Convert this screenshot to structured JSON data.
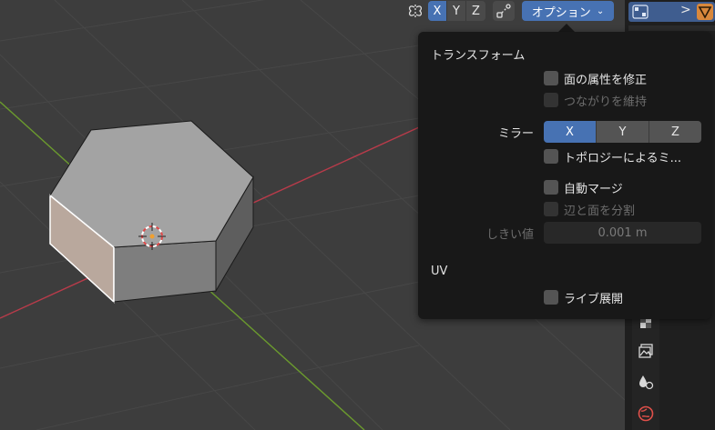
{
  "header": {
    "axes": [
      "X",
      "Y",
      "Z"
    ],
    "active_axis": "X",
    "options_label": "オプション"
  },
  "popup": {
    "transform": {
      "title": "トランスフォーム",
      "correct_face_attributes": "面の属性を修正",
      "keep_connected": "つながりを維持"
    },
    "mirror": {
      "label": "ミラー",
      "axes": [
        "X",
        "Y",
        "Z"
      ],
      "active": "X",
      "topology_mirror": "トポロジーによるミ..."
    },
    "automerge": {
      "label": "自動マージ",
      "split_edges_faces": "辺と面を分割",
      "threshold_label": "しきい値",
      "threshold_value": "0.001 m"
    },
    "uv": {
      "title": "UV",
      "live_unwrap": "ライブ展開"
    }
  },
  "icons": {
    "mirror": "mirror-butterfly-icon",
    "snap": "snap-icon",
    "chevron": "chevron-down-icon",
    "outliner_object": "object-icon",
    "outliner_mesh": "mesh-data-icon",
    "texture_tab": "texture-tab-icon",
    "image_tab": "image-tab-icon",
    "physics_tab": "physics-tab-icon",
    "world_tab": "world-tab-icon"
  },
  "colors": {
    "accent": "#4772b3",
    "popup_bg": "#181818",
    "viewport_bg": "#3d3d3d",
    "x_axis": "#b83b4a",
    "y_axis": "#6b9a2e"
  }
}
